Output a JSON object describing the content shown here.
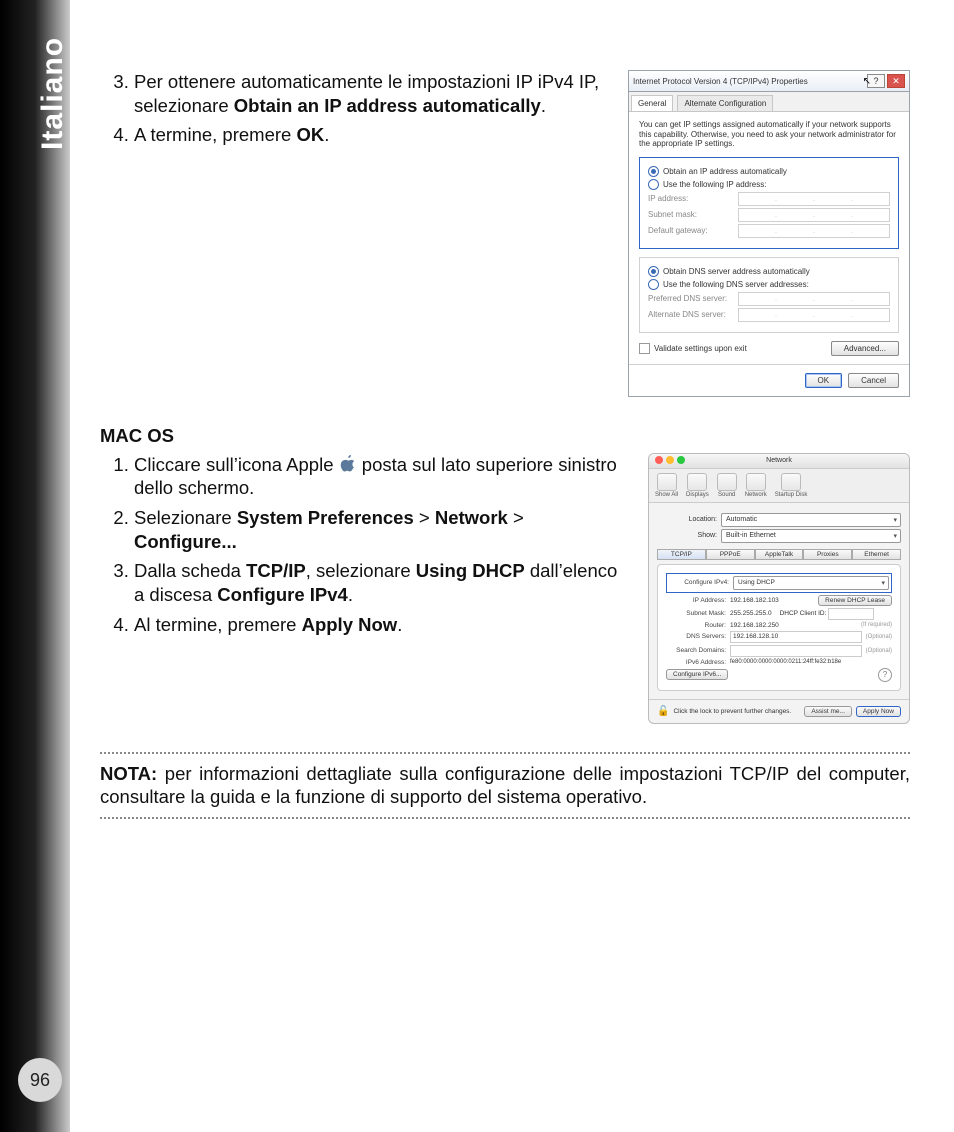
{
  "sidebar_language": "Italiano",
  "page_number": "96",
  "list_a": {
    "item3": {
      "pre": "Per ottenere automaticamente le impostazioni IP iPv4 IP, selezionare ",
      "bold": "Obtain an IP address automatically",
      "post": "."
    },
    "item4": {
      "pre": "A termine, premere ",
      "bold": "OK",
      "post": "."
    }
  },
  "mac_title": "MAC OS",
  "apple_alt": "apple-logo-icon",
  "list_b": {
    "item1": {
      "pre": "Cliccare sull’icona Apple ",
      "post": " posta sul lato superiore sinistro dello schermo."
    },
    "item2": {
      "pre": "Selezionare ",
      "b1": "System Preferences",
      "m1": " > ",
      "b2": "Network",
      "m2": " > ",
      "b3": "Configure..."
    },
    "item3": {
      "pre": "Dalla scheda ",
      "b1": "TCP/IP",
      "m1": ", selezionare ",
      "b2": "Using DHCP",
      "m2": " dall’elenco a discesa ",
      "b3": "Configure IPv4",
      "post": "."
    },
    "item4": {
      "pre": "Al termine, premere ",
      "bold": "Apply Now",
      "post": "."
    }
  },
  "note_label": "NOTA:",
  "note_text": " per informazioni dettagliate sulla configurazione delle impostazioni TCP/IP del computer, consultare la guida e la funzione di supporto del sistema operativo.",
  "win": {
    "title": "Internet Protocol Version 4 (TCP/IPv4) Properties",
    "tab_general": "General",
    "tab_alt": "Alternate Configuration",
    "desc": "You can get IP settings assigned automatically if your network supports this capability. Otherwise, you need to ask your network administrator for the appropriate IP settings.",
    "r1": "Obtain an IP address automatically",
    "r2": "Use the following IP address:",
    "f_ip": "IP address:",
    "f_mask": "Subnet mask:",
    "f_gw": "Default gateway:",
    "r3": "Obtain DNS server address automatically",
    "r4": "Use the following DNS server addresses:",
    "f_dns1": "Preferred DNS server:",
    "f_dns2": "Alternate DNS server:",
    "validate": "Validate settings upon exit",
    "advanced": "Advanced...",
    "ok": "OK",
    "cancel": "Cancel"
  },
  "mac": {
    "title": "Network",
    "tb": [
      "Show All",
      "Displays",
      "Sound",
      "Network",
      "Startup Disk"
    ],
    "loc_lbl": "Location:",
    "loc_val": "Automatic",
    "show_lbl": "Show:",
    "show_val": "Built-in Ethernet",
    "tabs": [
      "TCP/IP",
      "PPPoE",
      "AppleTalk",
      "Proxies",
      "Ethernet"
    ],
    "cfg_lbl": "Configure IPv4:",
    "cfg_val": "Using DHCP",
    "ip_lbl": "IP Address:",
    "ip_val": "192.168.182.103",
    "mask_lbl": "Subnet Mask:",
    "mask_val": "255.255.255.0",
    "router_lbl": "Router:",
    "router_val": "192.168.182.250",
    "dns_lbl": "DNS Servers:",
    "dns_val": "192.168.128.10",
    "sd_lbl": "Search Domains:",
    "ipv6_lbl": "IPv6 Address:",
    "ipv6_val": "fe80:0000:0000:0000:0211:24ff:fe32:b18e",
    "renew": "Renew DHCP Lease",
    "client_lbl": "DHCP Client ID:",
    "client_hint": "(If required)",
    "optional": "(Optional)",
    "cfg_ipv6": "Configure IPv6...",
    "lock_text": "Click the lock to prevent further changes.",
    "assist": "Assist me...",
    "apply": "Apply Now",
    "help": "?"
  }
}
